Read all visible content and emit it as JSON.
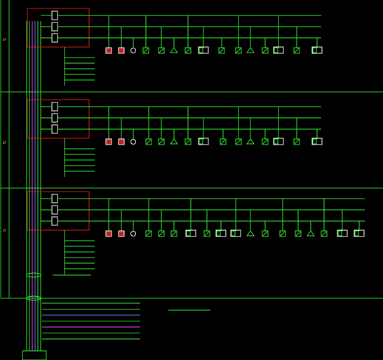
{
  "floors": [
    {
      "id": "floor-1",
      "side_label": "3F",
      "bus_labels": [
        "",
        "",
        ""
      ],
      "left_labels": [
        "",
        "",
        "",
        "",
        ""
      ],
      "device_labels": [
        "",
        "",
        "",
        "",
        "",
        ""
      ]
    },
    {
      "id": "floor-2",
      "side_label": "2F",
      "bus_labels": [
        "",
        "",
        ""
      ],
      "left_labels": [
        "",
        "",
        "",
        "",
        ""
      ],
      "device_labels": [
        "",
        "",
        "",
        "",
        "",
        ""
      ]
    },
    {
      "id": "floor-3",
      "side_label": "1F",
      "bus_labels": [
        "",
        "",
        ""
      ],
      "left_labels": [
        "",
        "",
        "",
        "",
        "",
        ""
      ],
      "device_labels": [
        "",
        "",
        "",
        "",
        "",
        "",
        ""
      ]
    }
  ],
  "bottom_notes": [
    "",
    "",
    "",
    "",
    "",
    "",
    ""
  ],
  "drawing_title": "",
  "panel_label": "",
  "colors": {
    "wire": "#33ee33",
    "frame": "#2ecc2e",
    "box": "#d81c1c",
    "device": "#ffffff",
    "accent_magenta": "#ff44ff",
    "accent_blue": "#6677ff",
    "text_green": "#33ee33",
    "text_yellow": "#ffff44"
  }
}
